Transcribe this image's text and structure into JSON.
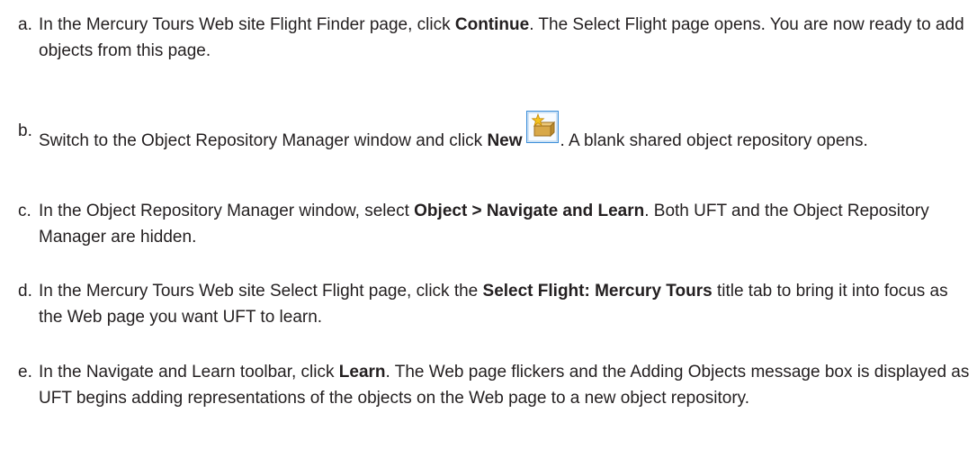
{
  "steps": [
    {
      "marker": "a.",
      "parts": [
        "In the Mercury Tours Web site Flight Finder page, click ",
        "Continue",
        ". The Select Flight page opens. You are now ready to add objects from this page."
      ]
    },
    {
      "marker": "b.",
      "parts": [
        "Switch to the Object Repository Manager window and click ",
        "New",
        ". A blank shared object repository opens."
      ],
      "icon": "new-repository-icon"
    },
    {
      "marker": "c.",
      "parts": [
        "In the Object Repository Manager window, select ",
        "Object > Navigate and Learn",
        ". Both UFT and the Object Repository Manager are hidden."
      ]
    },
    {
      "marker": "d.",
      "parts": [
        "In the Mercury Tours Web site Select Flight page, click the ",
        "Select Flight: Mercury Tours",
        " title tab to bring it into focus as the Web page you want UFT to learn."
      ]
    },
    {
      "marker": "e.",
      "parts": [
        "In the Navigate and Learn toolbar, click ",
        "Learn",
        ". The Web page flickers and the Adding Objects message box is displayed as UFT begins adding representations of the objects on the Web page to a new object repository."
      ]
    }
  ],
  "colors": {
    "text": "#231f20",
    "icon_border": "#3c8ed9",
    "icon_fill": "#d8a848",
    "icon_star": "#f4c21c"
  }
}
